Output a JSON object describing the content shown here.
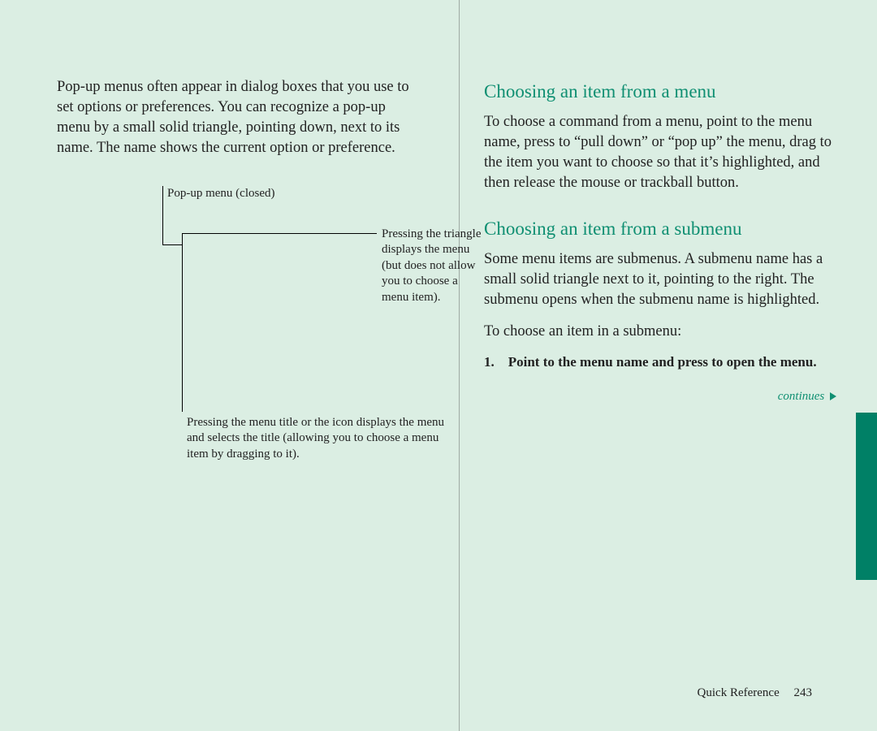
{
  "left": {
    "intro": "Pop-up menus often appear in dialog boxes that you use to set options or preferences. You can recognize a pop-up menu by a small solid triangle, pointing down, next to its name. The name shows the current option or preference.",
    "callout1": "Pop-up menu (closed)",
    "callout2": "Pressing the triangle displays the menu (but does not allow you to choose a menu item).",
    "callout3": "Pressing the menu title or the icon displays the menu and selects the title (allowing you to choose a menu item by dragging to it)."
  },
  "right": {
    "h1": "Choosing an item from a menu",
    "p1": "To choose a command from a menu, point to the menu name, press to “pull down” or “pop up” the menu, drag to the item you want to choose so that it’s highlighted, and then release the mouse or trackball button.",
    "h2": "Choosing an item from a submenu",
    "p2": "Some menu items are submenus. A submenu name has a small solid triangle next to it, pointing to the right. The submenu opens when the submenu name is highlighted.",
    "p3": "To choose an item in a submenu:",
    "step1": "1. Point to the menu name and press to open the menu.",
    "continues": "continues"
  },
  "footer": {
    "section": "Quick Reference",
    "page": "243"
  }
}
